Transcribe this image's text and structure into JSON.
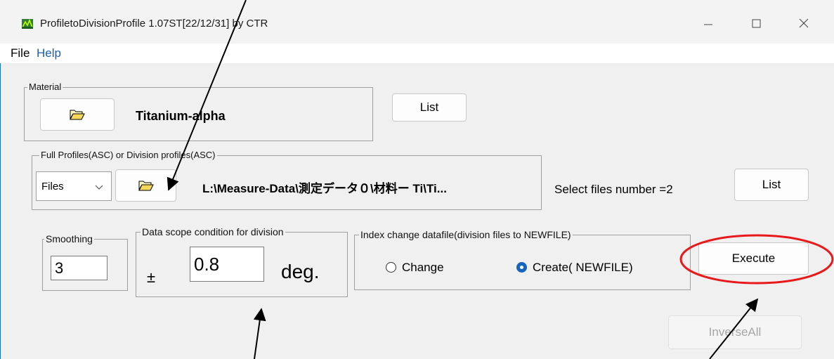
{
  "window": {
    "title": "ProfiletoDivisionProfile 1.07ST[22/12/31] by CTR",
    "minimize_glyph": "—",
    "maximize_glyph": "☐",
    "close_glyph": "✕"
  },
  "menu": {
    "items": [
      {
        "label": "File"
      },
      {
        "label": "Help"
      }
    ]
  },
  "material": {
    "group_label": "Material",
    "value": "Titanium-alpha",
    "list_button": "List"
  },
  "profiles": {
    "group_label": "Full Profiles(ASC) or Division profiles(ASC)",
    "mode_select": "Files",
    "path": "L:\\Measure-Data\\測定データ０\\材料ー Ti\\Ti...",
    "count_label": "Select files number =2",
    "list_button": "List"
  },
  "smoothing": {
    "group_label": "Smoothing",
    "value": "3"
  },
  "scope": {
    "group_label": "Data scope condition for division",
    "prefix": "±",
    "value": "0.8",
    "unit": "deg."
  },
  "index_change": {
    "group_label": "Index change datafile(division files to NEWFILE)",
    "options": [
      {
        "label": "Change",
        "selected": false
      },
      {
        "label": "Create( NEWFILE)",
        "selected": true
      }
    ]
  },
  "actions": {
    "execute": "Execute",
    "inverse_all": "InverseAll"
  },
  "colors": {
    "radio_selected": "#1565c0",
    "annotation_circle": "#e8191b",
    "menu_help": "#1a5fb4"
  },
  "icons": {
    "app": "app-logo-icon",
    "folder": "open-folder-icon"
  }
}
